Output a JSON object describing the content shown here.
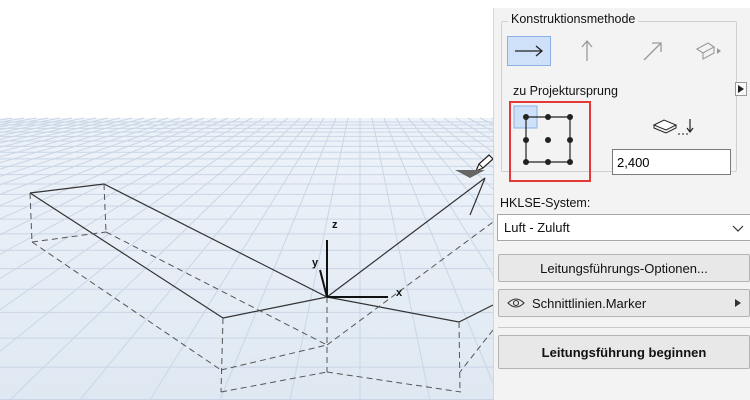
{
  "viewport": {
    "axis_x": "x",
    "axis_y": "y",
    "axis_z": "z"
  },
  "panel": {
    "group_title": "Konstruktionsmethode",
    "methods": [
      {
        "icon": "arrow-right-icon",
        "active": true
      },
      {
        "icon": "arrow-up-icon",
        "active": false
      },
      {
        "icon": "arrow-diagonal-icon",
        "active": false
      },
      {
        "icon": "slope-method-icon",
        "active": false
      }
    ],
    "origin_label": "zu Projektursprung",
    "selected_anchor": "top-left",
    "elevation_value": "2,400",
    "system_label": "HKLSE-System:",
    "system_value": "Luft - Zuluft",
    "options_button": "Leitungsführungs-Optionen...",
    "marker_label": "Schnittlinien.Marker",
    "start_button": "Leitungsführung beginnen"
  },
  "colors": {
    "accent_active": "#cfe1f8",
    "highlight": "#e53935",
    "grid_line": "#c9d6e6",
    "sky": "#ffffff",
    "ground": "#e9f0f7"
  }
}
